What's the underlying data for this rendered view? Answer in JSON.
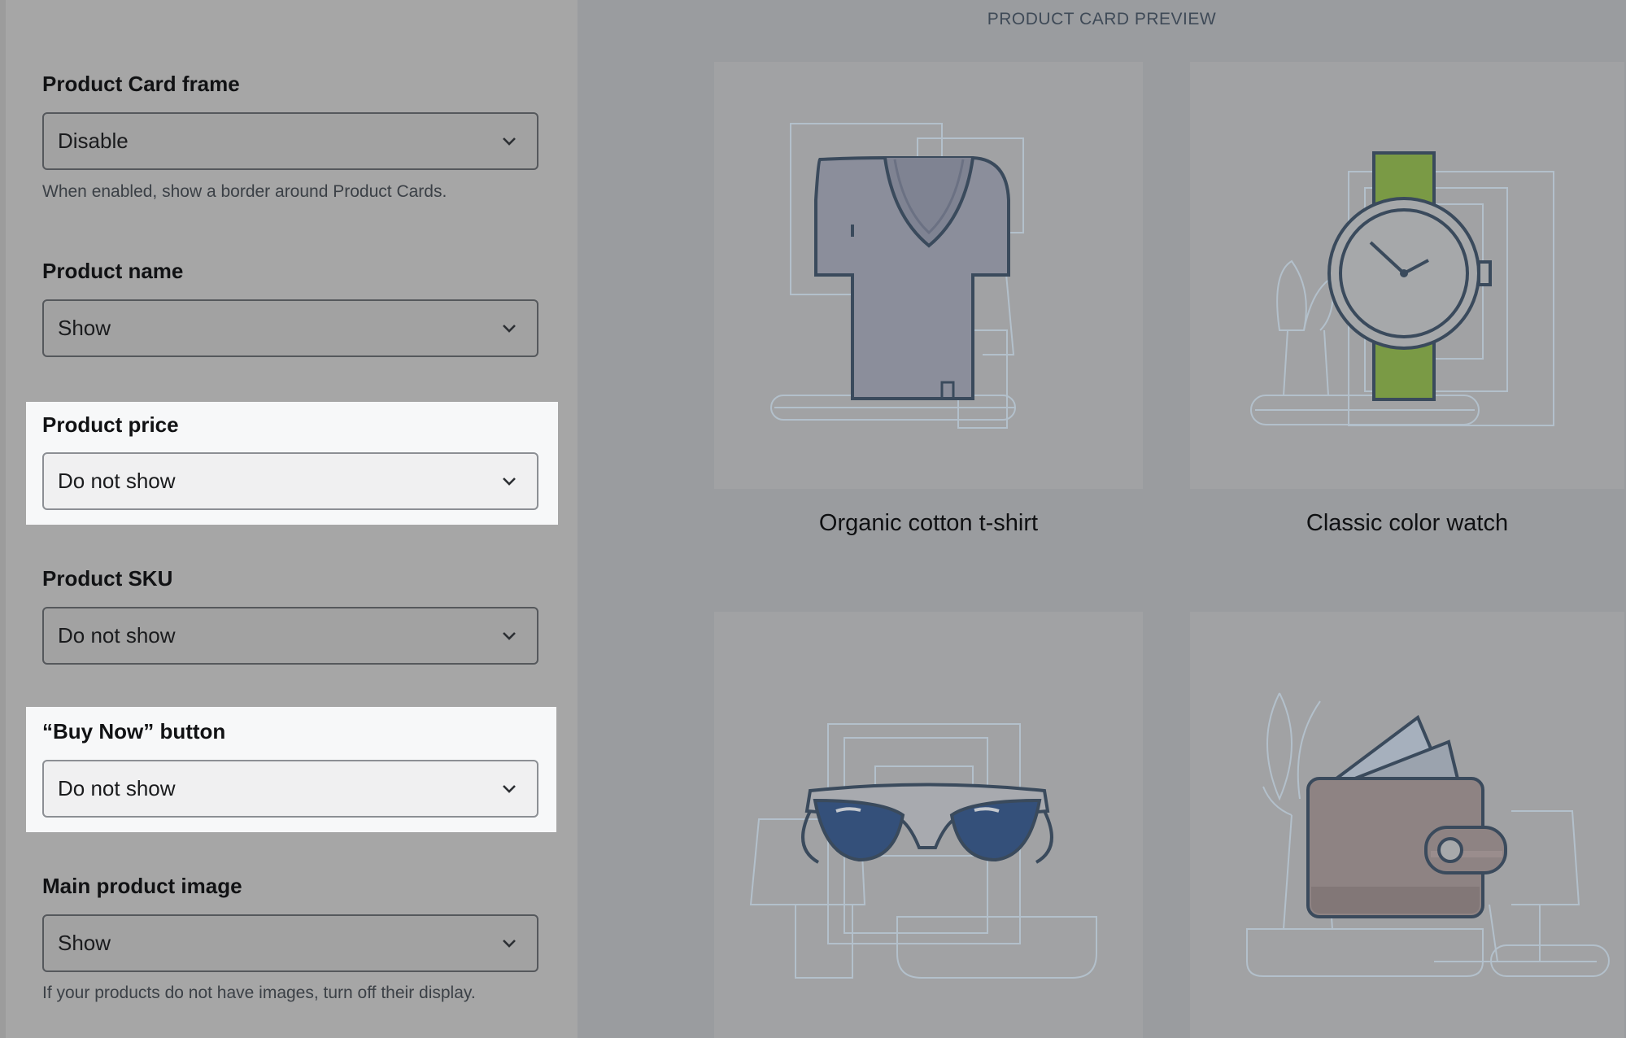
{
  "settings": {
    "fields": [
      {
        "label": "Product Card frame",
        "value": "Disable",
        "hint": "When enabled, show a border around Product Cards."
      },
      {
        "label": "Product name",
        "value": "Show"
      },
      {
        "label": "Product price",
        "value": "Do not show"
      },
      {
        "label": "Product SKU",
        "value": "Do not show"
      },
      {
        "label": "“Buy Now” button",
        "value": "Do not show"
      },
      {
        "label": "Main product image",
        "value": "Show",
        "hint": "If your products do not have images, turn off their display."
      }
    ]
  },
  "preview": {
    "title": "PRODUCT CARD PREVIEW",
    "cards": [
      {
        "name": "Organic cotton t-shirt",
        "icon": "tshirt-icon"
      },
      {
        "name": "Classic color watch",
        "icon": "watch-icon"
      },
      {
        "name": "",
        "icon": "sunglasses-icon"
      },
      {
        "name": "",
        "icon": "wallet-icon"
      }
    ]
  },
  "colors": {
    "highlight": "#f7f8f9",
    "panel": "#a6a6a6",
    "preview_bg": "#9a9c9f",
    "watch_strap": "#7a9a45",
    "lens": "#34507a",
    "wallet": "#8e8383"
  }
}
